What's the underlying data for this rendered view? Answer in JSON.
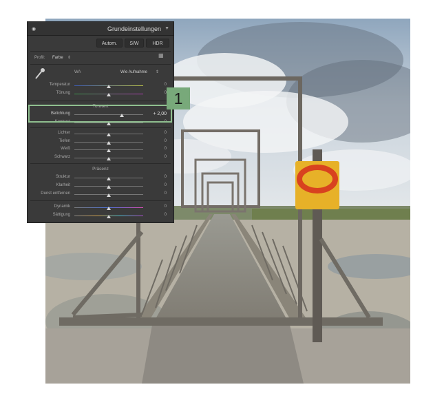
{
  "panel": {
    "title": "Grundeinstellungen",
    "buttons": {
      "auto": "Autom.",
      "bw": "S/W",
      "hdr": "HDR"
    },
    "profile": {
      "label": "Profil:",
      "value": "Farbe"
    },
    "wb": {
      "label": "WA",
      "value": "Wie Aufnahme"
    },
    "sliders": {
      "temperature": {
        "label": "Temperatur",
        "value": "0",
        "position": 0.5
      },
      "tint": {
        "label": "Tönung",
        "value": "0",
        "position": 0.5
      },
      "exposure": {
        "label": "Belichtung",
        "value": "+ 2,00",
        "position": 0.7
      },
      "contrast": {
        "label": "Kontrast",
        "value": "0",
        "position": 0.5
      },
      "highlights": {
        "label": "Lichter",
        "value": "0",
        "position": 0.5
      },
      "shadows": {
        "label": "Tiefen",
        "value": "0",
        "position": 0.5
      },
      "whites": {
        "label": "Weiß",
        "value": "0",
        "position": 0.5
      },
      "blacks": {
        "label": "Schwarz",
        "value": "0",
        "position": 0.5
      },
      "texture": {
        "label": "Struktur",
        "value": "0",
        "position": 0.5
      },
      "clarity": {
        "label": "Klarheit",
        "value": "0",
        "position": 0.5
      },
      "dehaze": {
        "label": "Dunst entfernen",
        "value": "0",
        "position": 0.5
      },
      "vibrance": {
        "label": "Dynamik",
        "value": "0",
        "position": 0.5
      },
      "saturation": {
        "label": "Sättigung",
        "value": "0",
        "position": 0.5
      }
    },
    "sections": {
      "tone": "Tonwert",
      "presence": "Präsenz"
    }
  },
  "callout": {
    "number": "1"
  },
  "colors": {
    "highlight": "#8fbf8f",
    "badge": "#78a97a",
    "panel_bg": "#3a3a3a"
  },
  "icons": {
    "visibility": "eye-icon",
    "eyedropper": "eyedropper-icon",
    "grid": "grid-icon"
  }
}
